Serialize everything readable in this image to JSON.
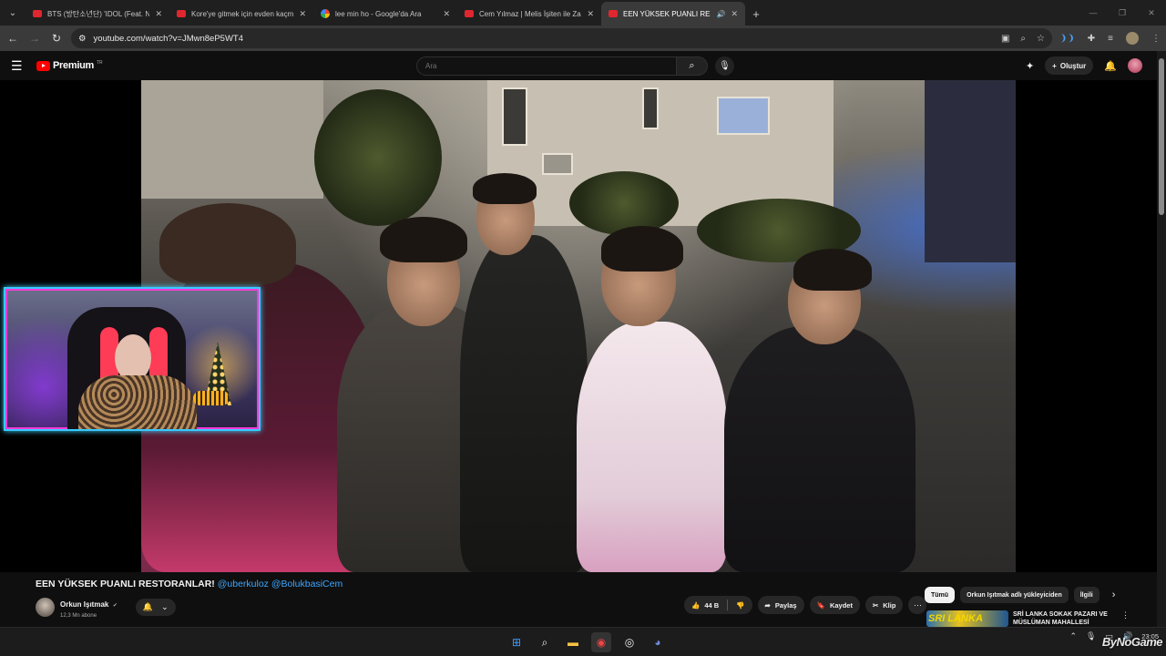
{
  "browser": {
    "tabs": [
      {
        "title": "BTS (방탄소년단) 'IDOL (Feat. Ni",
        "favicon": "youtube-icon",
        "active": false
      },
      {
        "title": "Kore'ye gitmek için evden kaçm",
        "favicon": "youtube-icon",
        "active": false
      },
      {
        "title": "lee min ho - Google'da Ara",
        "favicon": "google-icon",
        "active": false
      },
      {
        "title": "Cem Yılmaz | Melis İşiten ile Za",
        "favicon": "youtube-icon",
        "active": false
      },
      {
        "title": "EEN YÜKSEK PUANLI RESTO",
        "favicon": "youtube-icon",
        "active": true
      }
    ],
    "url": "youtube.com/watch?v=JMwn8eP5WT4"
  },
  "youtube": {
    "logo_text": "Premium",
    "logo_region": "TR",
    "search_placeholder": "Ara",
    "create_label": "Oluştur"
  },
  "video": {
    "title": "EEN YÜKSEK PUANLI RESTORANLAR!",
    "mentions": "@uberkuloz @BolukbasiCem",
    "channel_name": "Orkun Işıtmak",
    "subscribers": "12,3 Mn abone",
    "likes": "44 B",
    "share_label": "Paylaş",
    "save_label": "Kaydet",
    "clip_label": "Klip"
  },
  "sidebar_chips": [
    "Tümü",
    "Orkun Işıtmak adlı yükleyiciden",
    "İlgili"
  ],
  "recommendation": {
    "thumb_text": "SRI LANKA",
    "title": "SRİ LANKA SOKAK PAZARI VE MÜSLÜMAN MAHALLESİ"
  },
  "taskbar": {
    "time": "23:05",
    "date": "",
    "watermark": "ByNoGame"
  },
  "colors": {
    "youtube_red": "#ff0000",
    "link_blue": "#3ea6ff",
    "webcam_border": "#38c9ff"
  }
}
